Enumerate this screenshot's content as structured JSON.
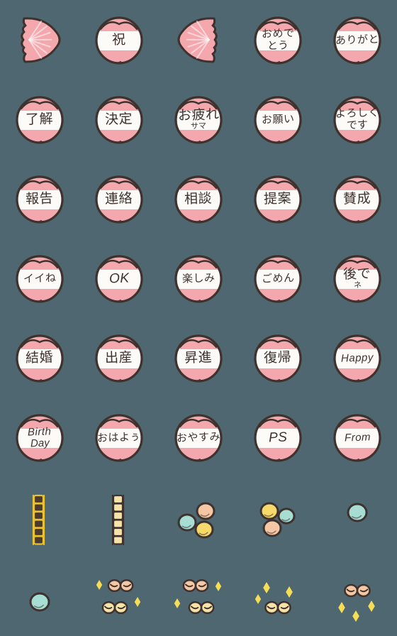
{
  "page": {
    "title": "Emoji sticker set preview",
    "background_color": "#4e6771",
    "columns": 5,
    "rows": 8
  },
  "palette": {
    "background": "#4e6771",
    "ink": "#3d322e",
    "pink": "#f4a7ad",
    "pink_light": "#f7bcc0",
    "white_band": "#fdfbf8",
    "gold": "#e8c230",
    "cream": "#f7e3a8",
    "dark_square": "#4a3a30",
    "mint": "#a8ddd4",
    "peach": "#f5c7a4",
    "yellow": "#f5d96b",
    "sparkle": "#f6dd53"
  },
  "stickers": [
    {
      "index": 1,
      "type": "fan",
      "direction": "right",
      "text": "",
      "text2": ""
    },
    {
      "index": 2,
      "type": "badge",
      "text": "祝",
      "text2": ""
    },
    {
      "index": 3,
      "type": "fan",
      "direction": "left",
      "text": "",
      "text2": ""
    },
    {
      "index": 4,
      "type": "badge",
      "text": "おめで",
      "text2": "とう",
      "style": "two"
    },
    {
      "index": 5,
      "type": "badge",
      "text": "ありがと",
      "text2": "",
      "style": "sml"
    },
    {
      "index": 6,
      "type": "badge",
      "text": "了解",
      "text2": ""
    },
    {
      "index": 7,
      "type": "badge",
      "text": "決定",
      "text2": ""
    },
    {
      "index": 8,
      "type": "badge",
      "text": "お疲れ",
      "text2": "サマ",
      "style": "sub"
    },
    {
      "index": 9,
      "type": "badge",
      "text": "お願い",
      "text2": "",
      "style": "sml"
    },
    {
      "index": 10,
      "type": "badge",
      "text": "よろしく",
      "text2": "です",
      "style": "two"
    },
    {
      "index": 11,
      "type": "badge",
      "text": "報告",
      "text2": ""
    },
    {
      "index": 12,
      "type": "badge",
      "text": "連絡",
      "text2": ""
    },
    {
      "index": 13,
      "type": "badge",
      "text": "相談",
      "text2": ""
    },
    {
      "index": 14,
      "type": "badge",
      "text": "提案",
      "text2": ""
    },
    {
      "index": 15,
      "type": "badge",
      "text": "賛成",
      "text2": ""
    },
    {
      "index": 16,
      "type": "badge",
      "text": "イイね",
      "text2": "",
      "style": "sml"
    },
    {
      "index": 17,
      "type": "badge",
      "text": "OK",
      "text2": "",
      "style": "lat"
    },
    {
      "index": 18,
      "type": "badge",
      "text": "楽しみ",
      "text2": "",
      "style": "sml"
    },
    {
      "index": 19,
      "type": "badge",
      "text": "ごめん",
      "text2": "",
      "style": "sml"
    },
    {
      "index": 20,
      "type": "badge",
      "text": "後で",
      "text2": "ネ",
      "style": "sub"
    },
    {
      "index": 21,
      "type": "badge",
      "text": "結婚",
      "text2": ""
    },
    {
      "index": 22,
      "type": "badge",
      "text": "出産",
      "text2": ""
    },
    {
      "index": 23,
      "type": "badge",
      "text": "昇進",
      "text2": ""
    },
    {
      "index": 24,
      "type": "badge",
      "text": "復帰",
      "text2": ""
    },
    {
      "index": 25,
      "type": "badge",
      "text": "Happy",
      "text2": "",
      "style": "lat2"
    },
    {
      "index": 26,
      "type": "badge",
      "text": "Birth",
      "text2": "Day",
      "style": "lat2"
    },
    {
      "index": 27,
      "type": "badge",
      "text": "おはよぅ",
      "text2": "",
      "style": "sml"
    },
    {
      "index": 28,
      "type": "badge",
      "text": "おやすみ",
      "text2": "",
      "style": "sml"
    },
    {
      "index": 29,
      "type": "badge",
      "text": "PS",
      "text2": "",
      "style": "lat"
    },
    {
      "index": 30,
      "type": "badge",
      "text": "From",
      "text2": "",
      "style": "lat2"
    },
    {
      "index": 31,
      "type": "chain-dark",
      "text": "",
      "text2": ""
    },
    {
      "index": 32,
      "type": "chain-cream",
      "text": "",
      "text2": ""
    },
    {
      "index": 33,
      "type": "balloons-3a",
      "text": "",
      "text2": ""
    },
    {
      "index": 34,
      "type": "balloons-3b",
      "text": "",
      "text2": ""
    },
    {
      "index": 35,
      "type": "balloon-1",
      "text": "",
      "text2": ""
    },
    {
      "index": 36,
      "type": "balloon-1b",
      "text": "",
      "text2": ""
    },
    {
      "index": 37,
      "type": "bows-2a",
      "text": "",
      "text2": ""
    },
    {
      "index": 38,
      "type": "bows-2b",
      "text": "",
      "text2": ""
    },
    {
      "index": 39,
      "type": "bow-sparkle",
      "text": "",
      "text2": ""
    },
    {
      "index": 40,
      "type": "bow-sparkle2",
      "text": "",
      "text2": ""
    }
  ]
}
